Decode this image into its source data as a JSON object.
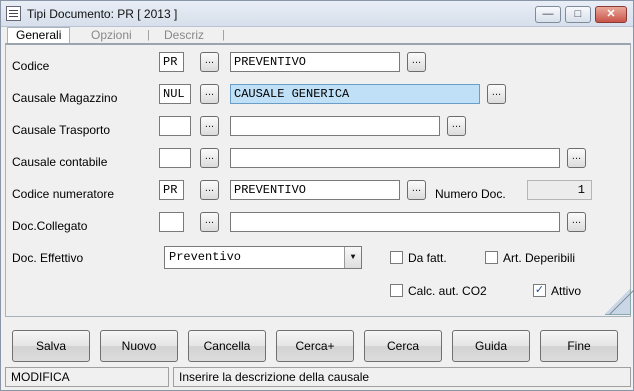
{
  "window": {
    "title": "Tipi Documento: PR [ 2013 ]"
  },
  "window_buttons": {
    "minimize": "—",
    "restore": "□",
    "close": "✕"
  },
  "tabs": [
    {
      "label": "Generali",
      "active": true
    },
    {
      "label": "Opzioni",
      "active": false
    },
    {
      "label": "Descriz",
      "active": false
    }
  ],
  "tab_separator": "|",
  "ellipsis": "...",
  "form": {
    "codice": {
      "label": "Codice",
      "code": "PR",
      "description": "PREVENTIVO"
    },
    "causale_magazzino": {
      "label": "Causale Magazzino",
      "code": "NUL",
      "description": "CAUSALE GENERICA"
    },
    "causale_trasporto": {
      "label": "Causale Trasporto",
      "code": "",
      "description": ""
    },
    "causale_contabile": {
      "label": "Causale contabile",
      "code": "",
      "description": ""
    },
    "codice_numeratore": {
      "label": "Codice numeratore",
      "code": "PR",
      "description": "PREVENTIVO",
      "numero_label": "Numero Doc.",
      "numero_value": "1"
    },
    "doc_collegato": {
      "label": "Doc.Collegato",
      "code": "",
      "description": ""
    },
    "doc_effettivo": {
      "label": "Doc. Effettivo",
      "value": "Preventivo",
      "arrow": "▼"
    }
  },
  "checkboxes": {
    "da_fatt": {
      "label": "Da fatt.",
      "checked": false
    },
    "art_deperibili": {
      "label": "Art. Deperibili",
      "checked": false
    },
    "calc_aut_co2": {
      "label": "Calc. aut. CO2",
      "checked": false
    },
    "attivo": {
      "label": "Attivo",
      "checked": true,
      "mark": "✓"
    }
  },
  "buttons": {
    "salva": "Salva",
    "nuovo": "Nuovo",
    "cancella": "Cancella",
    "cerca_plus": "Cerca+",
    "cerca": "Cerca",
    "guida": "Guida",
    "fine": "Fine"
  },
  "status": {
    "mode": "MODIFICA",
    "message": "Inserire la descrizione della causale"
  }
}
